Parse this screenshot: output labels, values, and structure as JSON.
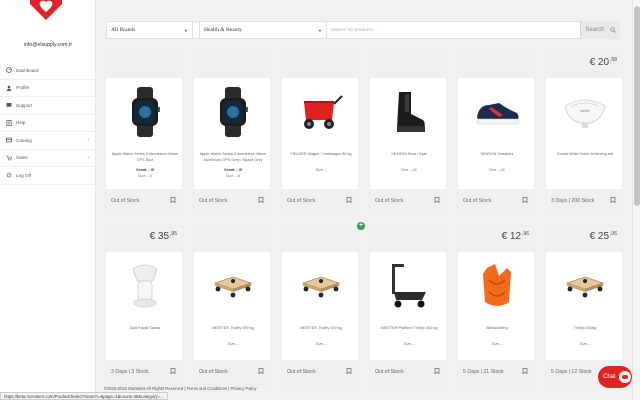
{
  "brand_color": "#e02424",
  "logo": {
    "icon": "heart-logo-icon"
  },
  "user": {
    "email": "info@elsupply.com.tr"
  },
  "nav": [
    {
      "label": "Dashboard",
      "icon": "dashboard-icon",
      "chevron": false
    },
    {
      "label": "Profile",
      "icon": "user-icon",
      "chevron": false
    },
    {
      "label": "Support",
      "icon": "support-icon",
      "chevron": false
    },
    {
      "label": "Help",
      "icon": "help-icon",
      "chevron": false
    },
    {
      "label": "Catalog",
      "icon": "catalog-icon",
      "chevron": true
    },
    {
      "label": "Sales",
      "icon": "sales-icon",
      "chevron": true
    },
    {
      "label": "Log Off",
      "icon": "logoff-icon",
      "chevron": false
    }
  ],
  "filters": {
    "brand": "All Brands",
    "category": "Health & Beauty",
    "search_placeholder": "Search for products...",
    "search_label": "Search"
  },
  "products": [
    {
      "price": "",
      "cents": "",
      "desc": "Apple Watch Series 5 Aluminium 44mm GPS Blue",
      "grade": "Grade – B",
      "size": "Size – S",
      "status": "Out of Stock",
      "image": "smartwatch-image"
    },
    {
      "price": "",
      "cents": "",
      "desc": "Apple Watch Series 5 Aluminium 40mm Aluminium GPS Grey / Space Grey",
      "grade": "Grade – B",
      "size": "Size – B",
      "status": "Out of Stock",
      "image": "smartwatch-image"
    },
    {
      "price": "",
      "cents": "",
      "desc": "FIELDER Wagon / Yardwagon 80 kg",
      "grade": "",
      "size": "Size –",
      "status": "Out of Stock",
      "image": "red-wagon-image"
    },
    {
      "price": "",
      "cents": "",
      "desc": "SEASON Boot / Sale",
      "grade": "",
      "size": "Size – 40",
      "status": "Out of Stock",
      "image": "ankle-boot-image"
    },
    {
      "price": "",
      "cents": "",
      "desc": "SEASON Sneakers",
      "grade": "",
      "size": "Size – 40",
      "status": "Out of Stock",
      "image": "sneaker-image"
    },
    {
      "price": "€ 20",
      "cents": ",58",
      "desc": "Dental White Teeth Whitening set",
      "grade": "",
      "size": "",
      "status": "3 Days | 200 Stock",
      "image": "teeth-whitening-image"
    },
    {
      "price": "€ 35",
      "cents": ",95",
      "desc": "Zuid Facial Sauna",
      "grade": "",
      "size": "",
      "status": "3 Days | 3 Stock",
      "image": "facial-sauna-image"
    },
    {
      "price": "",
      "cents": "",
      "desc": "MEISTER Trolley 250 kg",
      "grade": "",
      "size": "Size –",
      "status": "Out of Stock",
      "image": "dolly-image"
    },
    {
      "price": "",
      "cents": "",
      "desc": "MEISTER Trolley 200 kg",
      "grade": "",
      "size": "Size –",
      "status": "Out of Stock",
      "image": "dolly-image"
    },
    {
      "price": "",
      "cents": "",
      "desc": "MEISTER Platform Trolley 300 kg",
      "grade": "",
      "size": "Size –",
      "status": "Out of Stock",
      "image": "platform-cart-image"
    },
    {
      "price": "€ 12",
      "cents": ",96",
      "desc": "Behandeling",
      "grade": "",
      "size": "Size –",
      "status": "5 Days | 21 Stock",
      "image": "orange-bag-image"
    },
    {
      "price": "€ 25",
      "cents": ",06",
      "desc": "Trolley 200kg",
      "grade": "",
      "size": "Size –",
      "status": "5 Days | 12 Stock",
      "image": "dolly-image"
    }
  ],
  "footer": {
    "copyright": "©2016-2022 Monsters All Rights Reserved | Terms and Conditions | Privacy Policy"
  },
  "status_url": "https://beta.monsters.com/Product/Select?search=&page=1&count=48&category=...",
  "chat": {
    "label": "Chat"
  }
}
